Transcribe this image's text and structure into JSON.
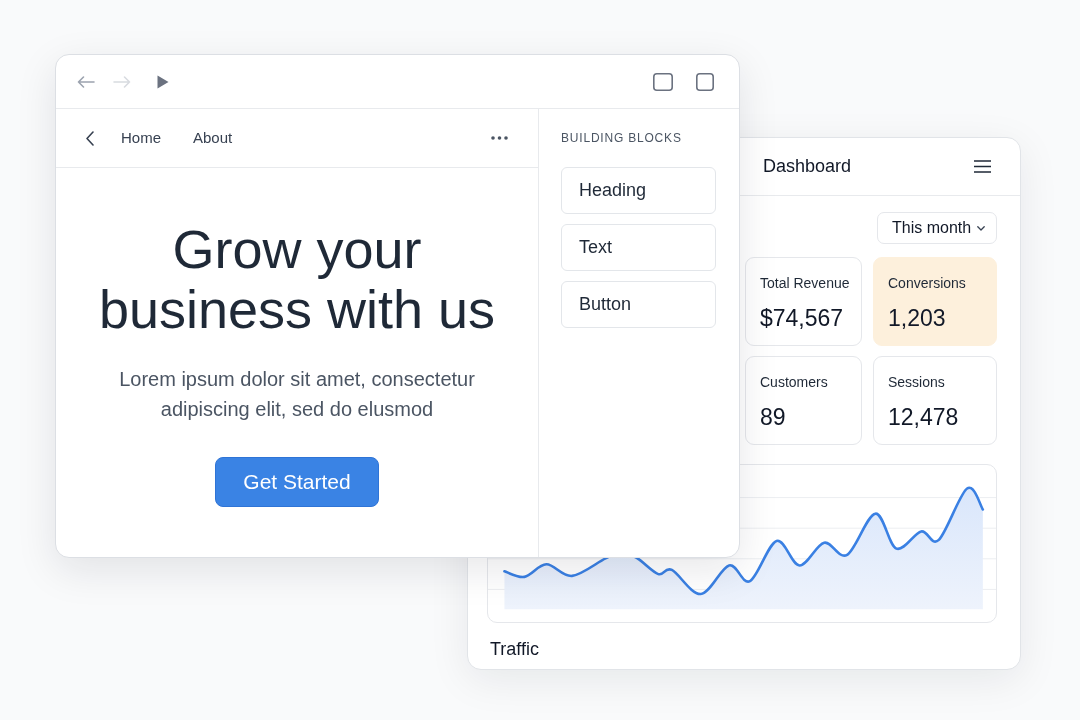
{
  "builder_window": {
    "toolbar": {
      "back": {
        "disabled": false
      },
      "forward": {
        "disabled": true
      }
    },
    "nav": {
      "links": [
        "Home",
        "About"
      ]
    },
    "hero": {
      "heading": "Grow your business with us",
      "text": "Lorem ipsum dolor sit amet, consectetur adipiscing elit, sed do elusmod",
      "button": "Get Started"
    },
    "sidebar": {
      "title": "BUILDING BLOCKS",
      "blocks": [
        "Heading",
        "Text",
        "Button"
      ]
    }
  },
  "dashboard_window": {
    "title": "Dashboard",
    "period_select": {
      "value": "This month"
    },
    "stats": [
      {
        "label": "Total Revenue",
        "value": "$74,567",
        "highlighted": false
      },
      {
        "label": "Conversions",
        "value": "1,203",
        "highlighted": true
      },
      {
        "label": "Customers",
        "value": "89",
        "highlighted": false
      },
      {
        "label": "Sessions",
        "value": "12,478",
        "highlighted": false
      }
    ],
    "chart": {
      "label": "Traffic"
    }
  }
}
